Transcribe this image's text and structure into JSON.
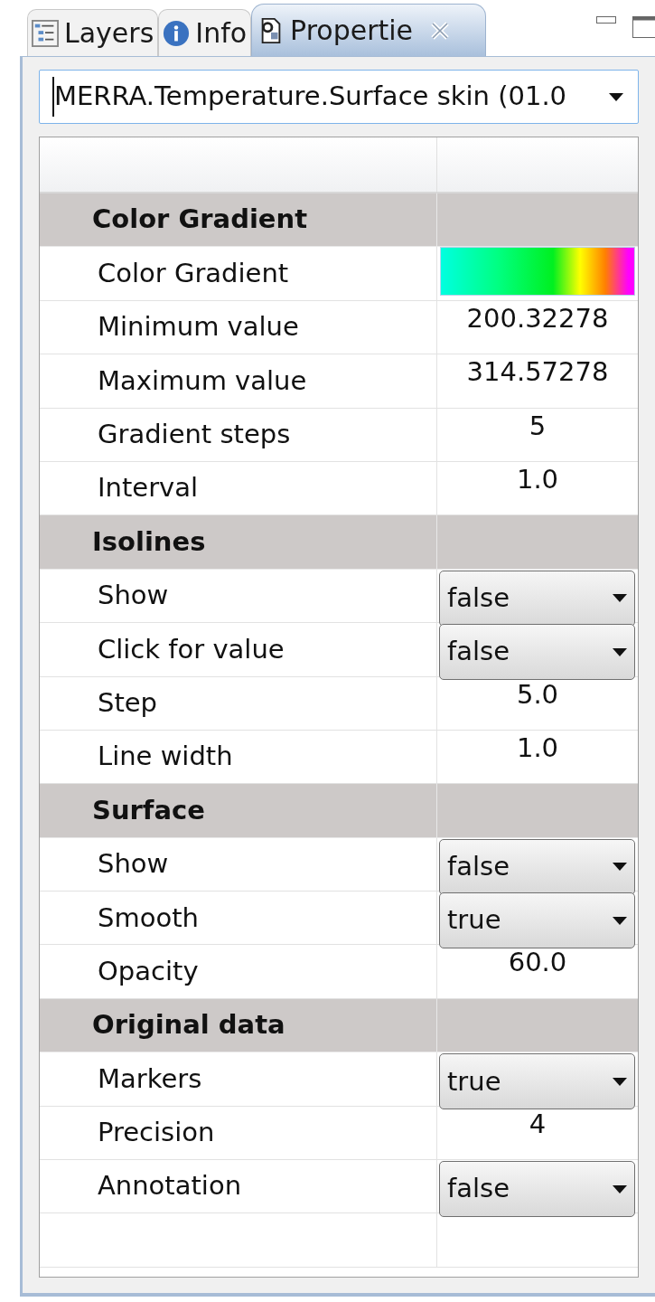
{
  "tabs": [
    {
      "label": "Layers",
      "kind": "layers",
      "selected": false
    },
    {
      "label": "Info",
      "kind": "info",
      "selected": false
    },
    {
      "label": "Propertie",
      "kind": "properties",
      "selected": true,
      "closable": true
    }
  ],
  "layer_select": {
    "value": "MERRA.Temperature.Surface skin  (01.0"
  },
  "properties": [
    {
      "kind": "section",
      "label": "Color Gradient"
    },
    {
      "kind": "gradient",
      "label": "Color Gradient"
    },
    {
      "kind": "text",
      "label": "Minimum value",
      "value": "200.32278"
    },
    {
      "kind": "text",
      "label": "Maximum value",
      "value": "314.57278"
    },
    {
      "kind": "text",
      "label": "Gradient steps",
      "value": "5"
    },
    {
      "kind": "text",
      "label": "Interval",
      "value": "1.0"
    },
    {
      "kind": "section",
      "label": "Isolines"
    },
    {
      "kind": "dropdown",
      "label": "Show",
      "value": "false"
    },
    {
      "kind": "dropdown",
      "label": "Click for value",
      "value": "false"
    },
    {
      "kind": "text",
      "label": "Step",
      "value": "5.0"
    },
    {
      "kind": "text",
      "label": "Line width",
      "value": "1.0"
    },
    {
      "kind": "section",
      "label": "Surface"
    },
    {
      "kind": "dropdown",
      "label": "Show",
      "value": "false"
    },
    {
      "kind": "dropdown",
      "label": "Smooth",
      "value": "true"
    },
    {
      "kind": "text",
      "label": "Opacity",
      "value": "60.0"
    },
    {
      "kind": "section",
      "label": "Original data"
    },
    {
      "kind": "dropdown",
      "label": "Markers",
      "value": "true"
    },
    {
      "kind": "text",
      "label": "Precision",
      "value": "4"
    },
    {
      "kind": "dropdown",
      "label": "Annotation",
      "value": "false"
    }
  ]
}
